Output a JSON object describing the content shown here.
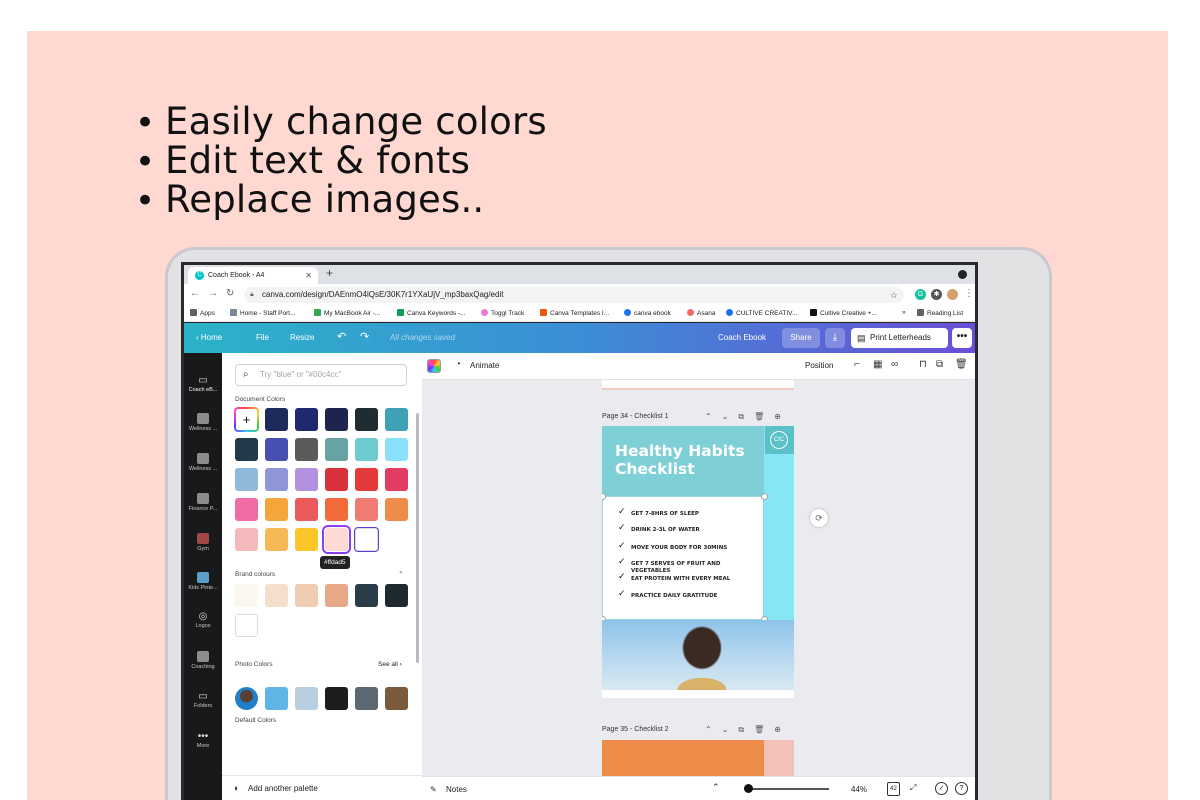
{
  "bullets": [
    "Easily change colors",
    "Edit text & fonts",
    "Replace images.."
  ],
  "browser": {
    "tab_title": "Coach Ebook - A4",
    "favicon_letter": "C",
    "new_tab": "+",
    "url": "canva.com/design/DAEnmO4lQsE/30K7r1YXaUjV_mp3baxQag/edit",
    "bookmarks": [
      {
        "label": "Apps",
        "color": "#5f6368"
      },
      {
        "label": "Home - Staff Port...",
        "color": "#7a8796"
      },
      {
        "label": "My MacBook Air -...",
        "color": "#34a853"
      },
      {
        "label": "Canva Keywords -...",
        "color": "#0f9d58"
      },
      {
        "label": "Toggl Track",
        "color": "#e57cd8"
      },
      {
        "label": "Canva Templates I...",
        "color": "#e8590c"
      },
      {
        "label": "canva ebook",
        "color": "#1a73e8"
      },
      {
        "label": "Asana",
        "color": "#f06a6a"
      },
      {
        "label": "CULTIVE CREATIV...",
        "color": "#1a73e8"
      },
      {
        "label": "Cultive Creative +...",
        "color": "#111111"
      }
    ],
    "bookmarks_overflow": "»",
    "reading_list": "Reading List"
  },
  "header": {
    "home": "Home",
    "file": "File",
    "resize": "Resize",
    "status": "All changes saved",
    "doc_title": "Coach Ebook",
    "share": "Share",
    "print": "Print Letterheads",
    "more": "•••"
  },
  "rail": [
    {
      "label": "Coach eB...",
      "glyph": "▭"
    },
    {
      "label": "Wellness ...",
      "glyph": ""
    },
    {
      "label": "Wellness ...",
      "glyph": ""
    },
    {
      "label": "Finance P...",
      "glyph": ""
    },
    {
      "label": "Gym",
      "glyph": ""
    },
    {
      "label": "Kids Pinte...",
      "glyph": ""
    },
    {
      "label": "Logos",
      "glyph": "◎"
    },
    {
      "label": "Coaching",
      "glyph": ""
    },
    {
      "label": "Folders",
      "glyph": "▭"
    },
    {
      "label": "More",
      "glyph": "•••"
    }
  ],
  "panel": {
    "search_placeholder": "Try \"blue\" or \"#00c4cc\"",
    "document_colors_title": "Document Colors",
    "document_colors": [
      [
        "",
        "#1e2a5a",
        "#20296f",
        "#1d2450",
        "#1f2d33",
        "#3ea1b5"
      ],
      [
        "#233a4a",
        "#4750b0",
        "#5a5a5a",
        "#67a3a3",
        "#6fcad0",
        "#89e0fa"
      ],
      [
        "#8fb9db",
        "#8f96d6",
        "#b291de",
        "#d9313b",
        "#e33a3a",
        "#e43d62"
      ],
      [
        "#f06ca6",
        "#f4a63b",
        "#ea5a5a",
        "#f26a3a",
        "#f07b72",
        "#f08c4a"
      ],
      [
        "#f6b9bb",
        "#f6b755",
        "#fcc52a",
        "#ffdad5",
        "#ffffff"
      ]
    ],
    "tooltip": "#ffdad5",
    "brand_title": "Brand colours",
    "brand_colors": [
      [
        "#fbf6ee",
        "#f4dfcc",
        "#efcdb2",
        "#e6a887",
        "#2a3c47",
        "#1e2a30"
      ],
      [
        "#ffffff"
      ]
    ],
    "photo_title": "Photo Colors",
    "see_all": "See all ›",
    "photo_colors": [
      "#5fb5e6",
      "#b9cfe0",
      "#1c1c1c",
      "#5c6872",
      "#7b5a3c"
    ],
    "default_title": "Default Colors",
    "add_palette": "Add another palette"
  },
  "toolbar": {
    "animate": "Animate",
    "position": "Position"
  },
  "canvas": {
    "page34_label": "Page 34 - Checklist 1",
    "page35_label": "Page 35 - Checklist 2",
    "page_tools": "⌃⌄⧉🗑⊕",
    "title": "Healthy Habits Checklist",
    "logo": "CIC",
    "check_mark": "✓",
    "items": [
      "GET 7-8HRS OF SLEEP",
      "DRINK 2-3L OF WATER",
      "MOVE YOUR BODY FOR 30MINS",
      "GET 7 SERVES OF FRUIT AND VEGETABLES",
      "EAT PROTEIN WITH EVERY MEAL",
      "PRACTICE DAILY GRATITUDE"
    ]
  },
  "bottombar": {
    "notes": "Notes",
    "zoom": "44%",
    "pages": "42",
    "zoom_fraction": 0.44
  }
}
